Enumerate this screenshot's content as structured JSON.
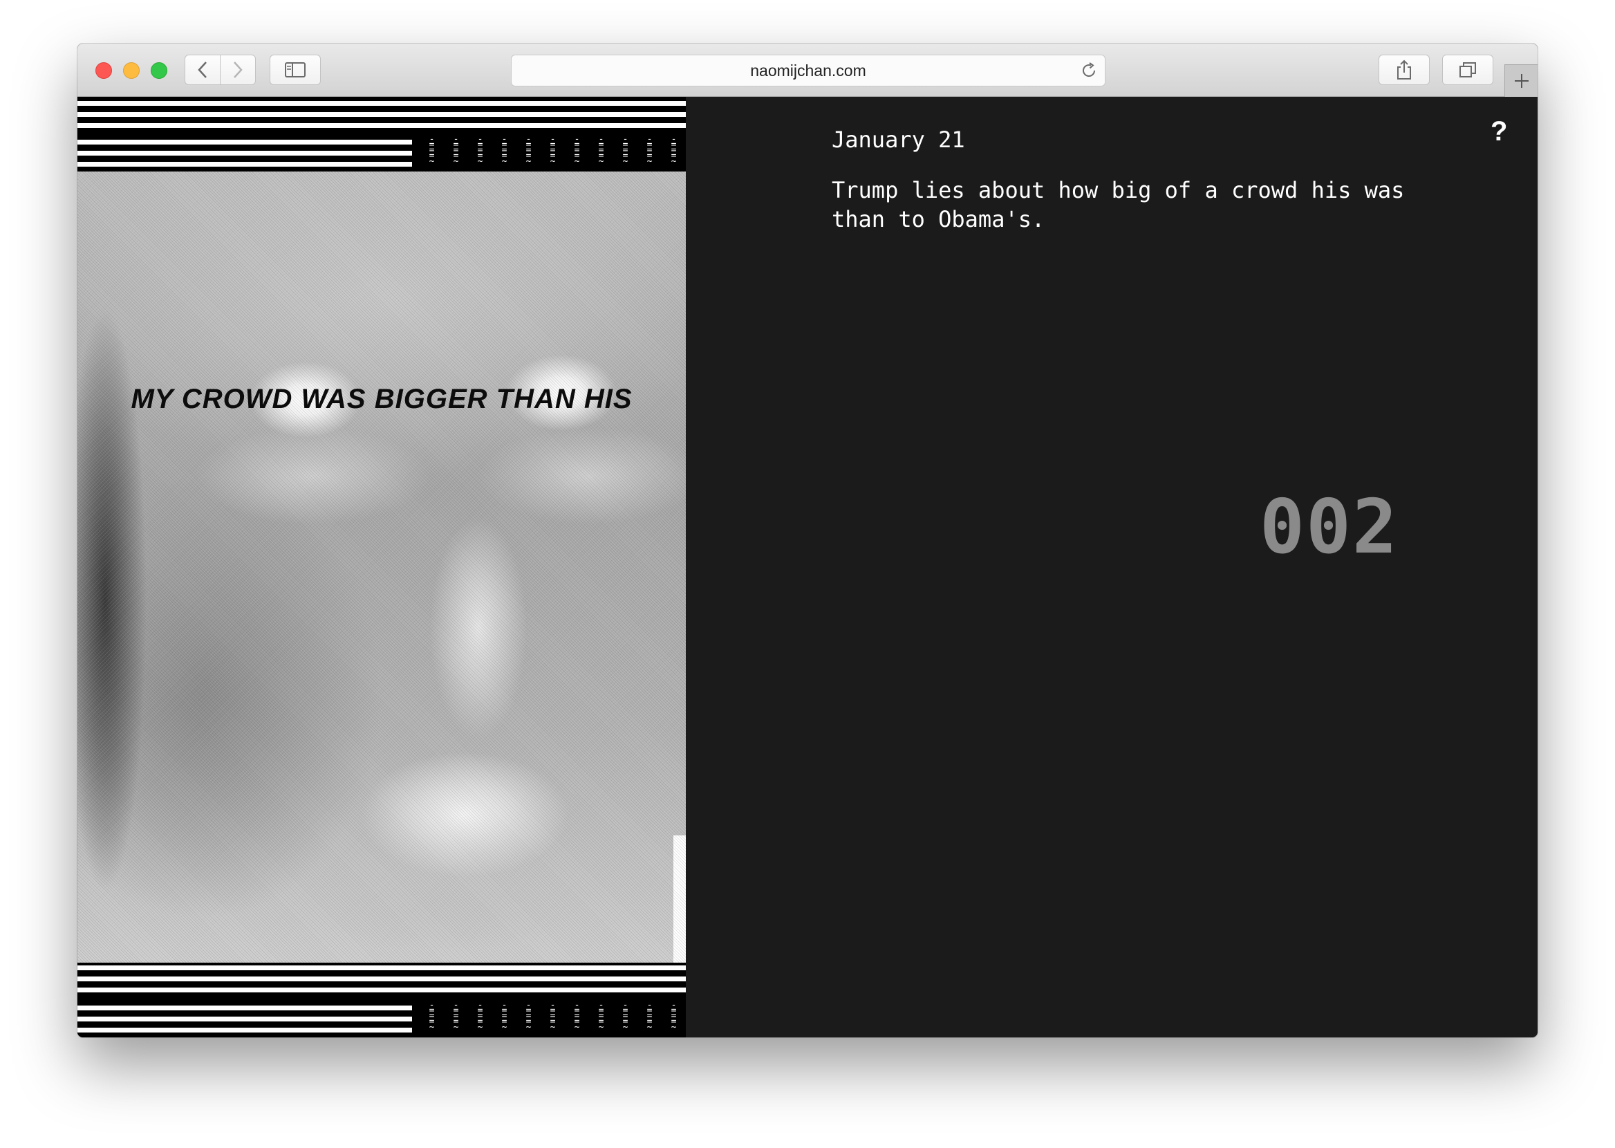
{
  "browser": {
    "url": "naomijchan.com",
    "icons": {
      "back": "chevron-left-icon",
      "forward": "chevron-right-icon",
      "sidebar": "sidebar-icon",
      "reload": "reload-icon",
      "share": "share-icon",
      "tabs": "tabs-icon",
      "new_tab": "plus-icon"
    }
  },
  "poster": {
    "headline": "MY CROWD WAS BIGGER THAN HIS"
  },
  "entry": {
    "date": "January 21",
    "description": "Trump lies about how big of a crowd his was than to Obama's.",
    "number": "002",
    "help": "?"
  },
  "colors": {
    "page_background": "#1b1b1b",
    "text": "#ffffff",
    "counter": "#8a8a8a"
  }
}
